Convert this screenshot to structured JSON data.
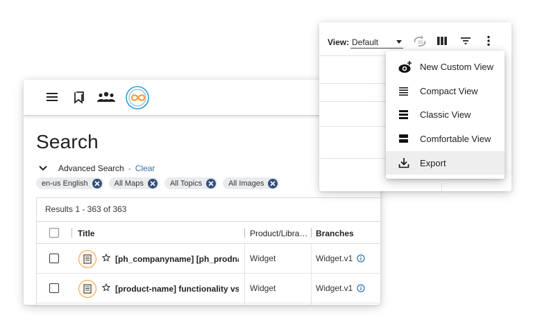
{
  "topbar": {
    "menu_icon": "hamburger-icon",
    "bookmark_icon": "bookmarks-icon",
    "users_icon": "group-icon",
    "logo_icon": "brand-logo-icon"
  },
  "page": {
    "title": "Search"
  },
  "advanced_search": {
    "label": "Advanced Search",
    "separator": "-",
    "clear_label": "Clear"
  },
  "filters": [
    {
      "label": "en-us English"
    },
    {
      "label": "All Maps"
    },
    {
      "label": "All Topics"
    },
    {
      "label": "All Images"
    }
  ],
  "results": {
    "count_text": "Results 1 - 363 of 363",
    "columns": [
      "Title",
      "Product/Libra…",
      "Branches"
    ],
    "rows": [
      {
        "title": "[ph_companyname] [ph_prodna…",
        "product": "Widget",
        "branch": "Widget.v1"
      },
      {
        "title": "[product-name] functionality vs. […",
        "product": "Widget",
        "branch": "Widget.v1"
      }
    ]
  },
  "view_toolbar": {
    "label": "View:",
    "selected_view": "Default",
    "icons": [
      "rotate-3d-icon",
      "columns-icon",
      "filter-icon",
      "more-vert-icon"
    ]
  },
  "view_menu": {
    "items": [
      {
        "label": "New Custom View",
        "icon": "eye-add-icon"
      },
      {
        "label": "Compact View",
        "icon": "compact-lines-icon"
      },
      {
        "label": "Classic View",
        "icon": "classic-lines-icon"
      },
      {
        "label": "Comfortable View",
        "icon": "comfortable-lines-icon"
      },
      {
        "label": "Export",
        "icon": "download-icon"
      }
    ]
  },
  "colors": {
    "accent_orange": "#f0a040",
    "logo_blue": "#2a9fd6",
    "chip_close": "#33507a",
    "link_blue": "#3a6ea5",
    "menu_hover": "#eeeeee"
  }
}
